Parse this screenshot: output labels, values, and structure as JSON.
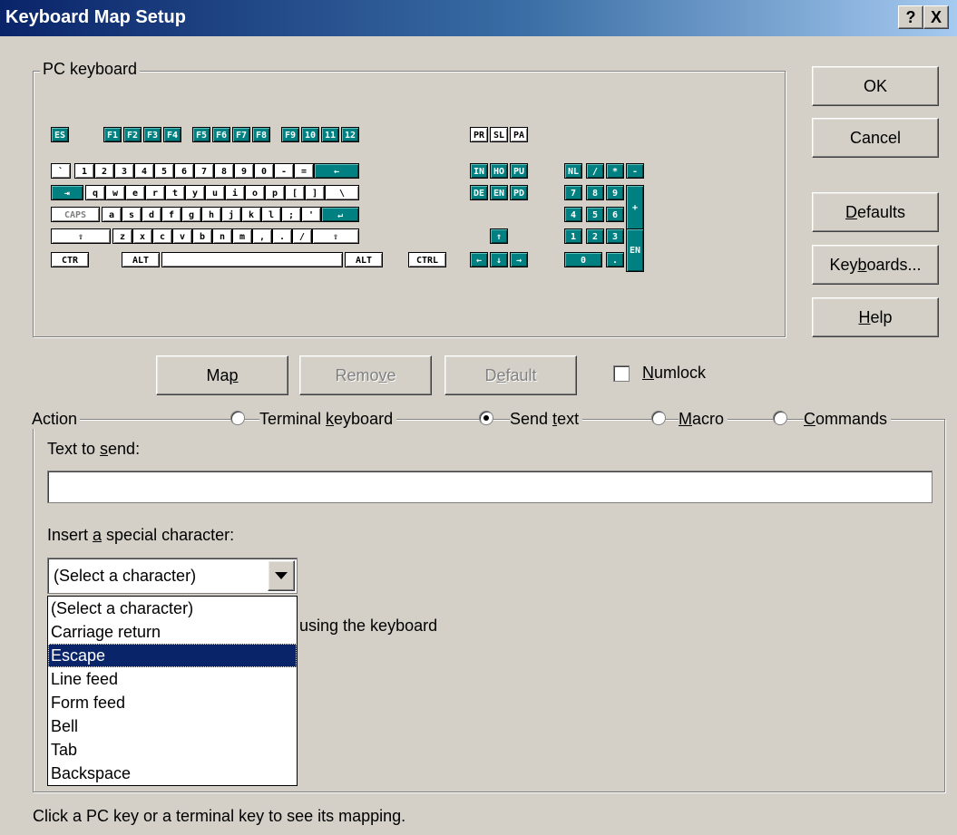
{
  "window": {
    "title": "Keyboard Map Setup",
    "help_button": "?",
    "close_button": "X"
  },
  "pc_keyboard": {
    "label": "PC keyboard",
    "rows": [
      [
        "ES",
        "F1",
        "F2",
        "F3",
        "F4",
        "F5",
        "F6",
        "F7",
        "F8",
        "F9",
        "10",
        "11",
        "12",
        "PR",
        "SL",
        "PA"
      ],
      [
        "`",
        "1",
        "2",
        "3",
        "4",
        "5",
        "6",
        "7",
        "8",
        "9",
        "0",
        "-",
        "=",
        "←",
        "IN",
        "HO",
        "PU",
        "NL",
        "/",
        "*",
        "-"
      ],
      [
        "⇥",
        "q",
        "w",
        "e",
        "r",
        "t",
        "y",
        "u",
        "i",
        "o",
        "p",
        "[",
        "]",
        "\\",
        "DE",
        "EN",
        "PD",
        "7",
        "8",
        "9",
        "+"
      ],
      [
        "CAPS",
        "a",
        "s",
        "d",
        "f",
        "g",
        "h",
        "j",
        "k",
        "l",
        ";",
        "'",
        "↵",
        "4",
        "5",
        "6"
      ],
      [
        "⇧",
        "z",
        "x",
        "c",
        "v",
        "b",
        "n",
        "m",
        ",",
        ".",
        "/",
        "⇧",
        "↑",
        "1",
        "2",
        "3",
        "EN"
      ],
      [
        "CTR",
        "ALT",
        "",
        "ALT",
        "CTRL",
        "←",
        "↓",
        "→",
        "0",
        "."
      ]
    ]
  },
  "buttons": {
    "ok": "OK",
    "cancel": "Cancel",
    "defaults": "Defaults",
    "keyboards": "Keyboards...",
    "help": "Help"
  },
  "map_buttons": {
    "map": "Map",
    "remove": "Remove",
    "default": "Default"
  },
  "numlock": {
    "label": "Numlock",
    "checked": false
  },
  "action": {
    "label": "Action",
    "options": [
      {
        "label": "Terminal keyboard",
        "selected": false
      },
      {
        "label": "Send text",
        "selected": true
      },
      {
        "label": "Macro",
        "selected": false
      },
      {
        "label": "Commands",
        "selected": false
      }
    ],
    "text_to_send_label": "Text to send:",
    "text_to_send_value": "",
    "special_char_label": "Insert a special character:",
    "special_char_selected": "(Select a character)",
    "special_char_options": [
      "(Select a character)",
      "Carriage return",
      "Escape",
      "Line feed",
      "Form feed",
      "Bell",
      "Tab",
      "Backspace"
    ],
    "highlighted_option": "Escape",
    "partial_hidden_text": "using the keyboard"
  },
  "status_text": "Click a PC key or a terminal key to see its mapping."
}
